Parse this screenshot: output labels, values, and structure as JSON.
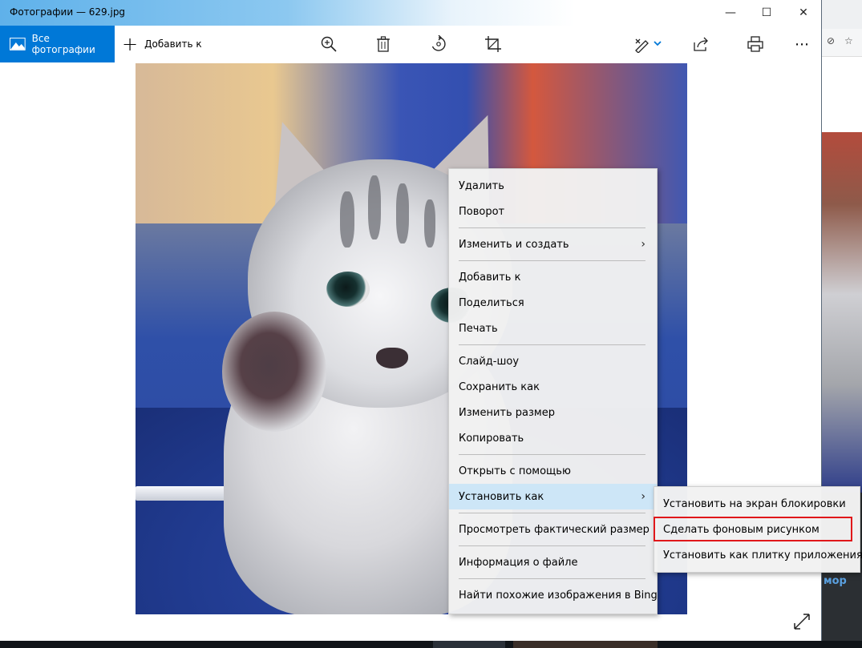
{
  "window": {
    "title": "Фотографии — 629.jpg",
    "minimize_glyph": "—",
    "maximize_glyph": "☐",
    "close_glyph": "✕"
  },
  "toolbar": {
    "all_photos_label": "Все фотографии",
    "add_to_label": "Добавить к",
    "add_to_icon": "+",
    "more_glyph": "⋯",
    "icons": [
      "photos-app-icon",
      "zoom-icon",
      "delete-icon",
      "rotate-icon",
      "crop-icon",
      "edit-create-icon",
      "share-icon",
      "print-icon",
      "more-icon"
    ],
    "accent": "#0078d7"
  },
  "context_menu": {
    "items": [
      {
        "label": "Удалить"
      },
      {
        "label": "Поворот"
      },
      {
        "label": "Изменить и создать",
        "submenu": true
      },
      {
        "label": "Добавить к"
      },
      {
        "label": "Поделиться"
      },
      {
        "label": "Печать"
      },
      {
        "label": "Слайд-шоу"
      },
      {
        "label": "Сохранить как"
      },
      {
        "label": "Изменить размер"
      },
      {
        "label": "Копировать"
      },
      {
        "label": "Открыть с помощью"
      },
      {
        "label": "Установить как",
        "submenu": true,
        "active": true
      },
      {
        "label": "Просмотреть фактический размер"
      },
      {
        "label": "Информация о файле"
      },
      {
        "label": "Найти похожие изображения в Bing"
      }
    ],
    "chevron": "›"
  },
  "submenu": {
    "items": [
      {
        "label": "Установить на экран блокировки"
      },
      {
        "label": "Сделать фоновым рисунком",
        "highlighted": true
      },
      {
        "label": "Установить как плитку приложения"
      }
    ],
    "highlight_color": "#e0171a"
  },
  "background": {
    "partial_text": "мор"
  }
}
